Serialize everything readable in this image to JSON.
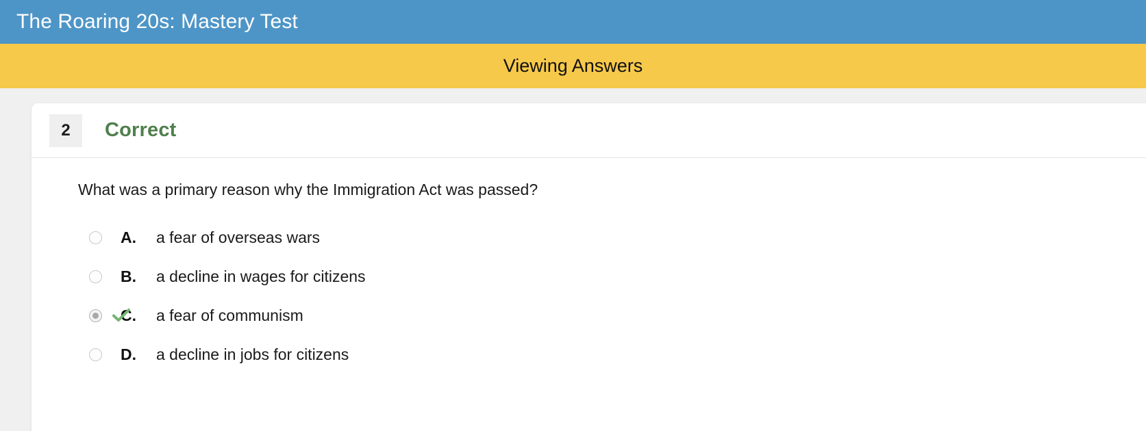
{
  "header": {
    "title": "The Roaring 20s: Mastery Test",
    "background_color": "#4e95c7",
    "text_color": "#ffffff"
  },
  "status_banner": {
    "text": "Viewing Answers",
    "background_color": "#f7c94a",
    "text_color": "#111111"
  },
  "question_card": {
    "number": "2",
    "result_label": "Correct",
    "result_color": "#4f7f4c",
    "question_text": "What was a primary reason why the Immigration Act was passed?",
    "correct_marker_icon": "check-icon",
    "options": [
      {
        "letter": "A.",
        "text": "a fear of overseas wars",
        "selected": false,
        "is_correct": false
      },
      {
        "letter": "B.",
        "text": "a decline in wages for citizens",
        "selected": false,
        "is_correct": false
      },
      {
        "letter": "C.",
        "text": "a fear of communism",
        "selected": true,
        "is_correct": true
      },
      {
        "letter": "D.",
        "text": "a decline in jobs for citizens",
        "selected": false,
        "is_correct": false
      }
    ]
  }
}
